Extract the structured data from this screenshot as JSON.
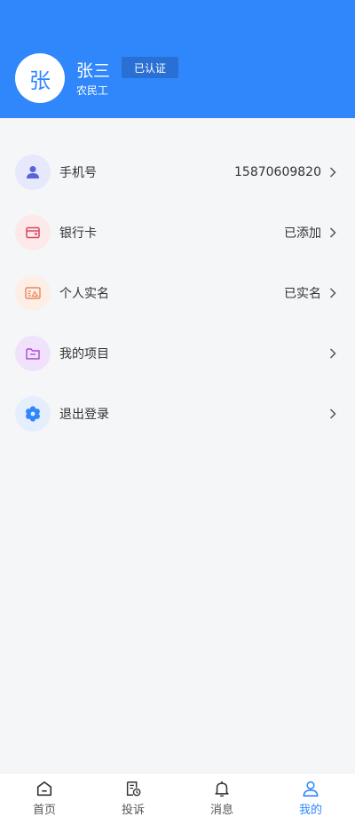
{
  "profile": {
    "avatar_char": "张",
    "name": "张三",
    "role": "农民工",
    "verify_badge": "已认证"
  },
  "menu": [
    {
      "label": "手机号",
      "value": "15870609820",
      "icon": "person-icon",
      "icon_bg": "#e6e8fb",
      "icon_color": "#5a63d8"
    },
    {
      "label": "银行卡",
      "value": "已添加",
      "icon": "wallet-icon",
      "icon_bg": "#fde8ea",
      "icon_color": "#d9485b"
    },
    {
      "label": "个人实名",
      "value": "已实名",
      "icon": "id-card-icon",
      "icon_bg": "#fdeee6",
      "icon_color": "#e7885a"
    },
    {
      "label": "我的项目",
      "value": "",
      "icon": "folder-icon",
      "icon_bg": "#f1e2fb",
      "icon_color": "#a748d8"
    },
    {
      "label": "退出登录",
      "value": "",
      "icon": "gear-icon",
      "icon_bg": "#e5eefd",
      "icon_color": "#2f87fb"
    }
  ],
  "tabbar": [
    {
      "label": "首页",
      "icon": "home-icon",
      "active": false
    },
    {
      "label": "投诉",
      "icon": "complaint-icon",
      "active": false
    },
    {
      "label": "消息",
      "icon": "bell-icon",
      "active": false
    },
    {
      "label": "我的",
      "icon": "user-icon",
      "active": true
    }
  ],
  "colors": {
    "primary": "#2f87fb",
    "background": "#f5f6f8"
  }
}
